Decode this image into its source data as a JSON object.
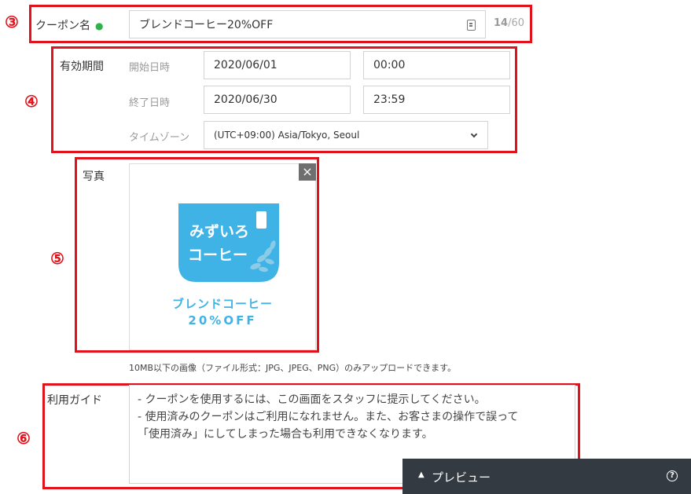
{
  "markers": {
    "m3": "③",
    "m4": "④",
    "m5": "⑤",
    "m6": "⑥"
  },
  "coupon_name": {
    "label": "クーポン名",
    "required_dot": "●",
    "value": "ブレンドコーヒー20%OFF",
    "count_current": "14",
    "count_max": "/60"
  },
  "validity": {
    "label": "有効期間",
    "start_label": "開始日時",
    "start_date": "2020/06/01",
    "start_time": "00:00",
    "end_label": "終了日時",
    "end_date": "2020/06/30",
    "end_time": "23:59",
    "timezone_label": "タイムゾーン",
    "timezone_value": "(UTC+09:00) Asia/Tokyo, Seoul"
  },
  "photo": {
    "label": "写真",
    "close": "×",
    "logo_line1": "みずいろ",
    "logo_line2": "コーヒー",
    "caption_line1": "ブレンドコーヒー",
    "caption_line2": "20%OFF",
    "note": "10MB以下の画像（ファイル形式：JPG、JPEG、PNG）のみアップロードできます。"
  },
  "guide": {
    "label": "利用ガイド",
    "lines": [
      "- クーポンを使用するには、この画面をスタッフに提示してください。",
      "- 使用済みのクーポンはご利用になれません。また、お客さまの操作で誤って",
      "「使用済み」にしてしまった場合も利用できなくなります。"
    ]
  },
  "preview": {
    "label": "プレビュー",
    "arrow": "▲",
    "help": "?"
  },
  "colors": {
    "annotation_red": "#e0121b",
    "accent_blue": "#3fb3e6",
    "bar": "#333a42",
    "required_green": "#2db34a"
  }
}
